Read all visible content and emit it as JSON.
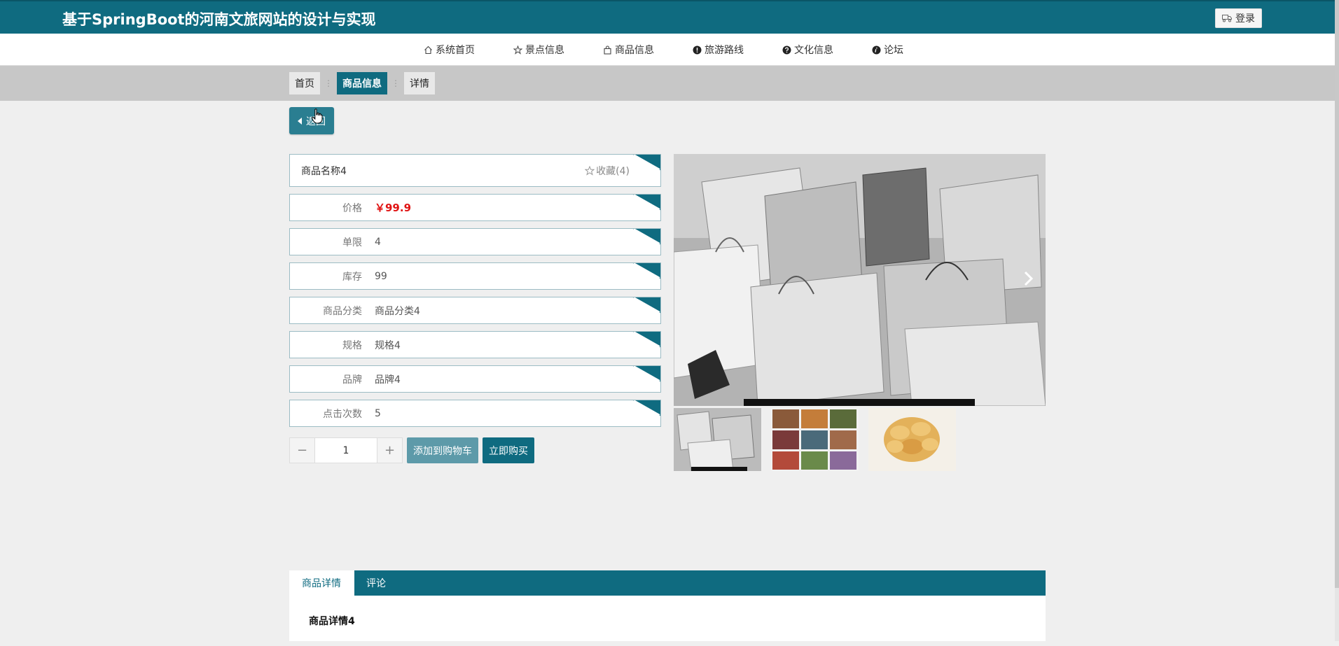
{
  "header": {
    "site_title": "基于SpringBoot的河南文旅网站的设计与实现",
    "login_label": "登录"
  },
  "nav": [
    {
      "label": "系统首页",
      "icon": "home-icon"
    },
    {
      "label": "景点信息",
      "icon": "star-icon"
    },
    {
      "label": "商品信息",
      "icon": "bag-icon"
    },
    {
      "label": "旅游路线",
      "icon": "info-icon"
    },
    {
      "label": "文化信息",
      "icon": "question-icon"
    },
    {
      "label": "论坛",
      "icon": "info-icon"
    }
  ],
  "breadcrumb": [
    {
      "label": "首页",
      "active": false
    },
    {
      "label": "商品信息",
      "active": true
    },
    {
      "label": "详情",
      "active": false
    }
  ],
  "back_label": "返回",
  "product": {
    "name": "商品名称4",
    "favorite_label": "收藏(4)",
    "fields": [
      {
        "label": "价格",
        "value": "￥99.9",
        "kind": "price"
      },
      {
        "label": "单限",
        "value": "4"
      },
      {
        "label": "库存",
        "value": "99"
      },
      {
        "label": "商品分类",
        "value": "商品分类4"
      },
      {
        "label": "规格",
        "value": "规格4"
      },
      {
        "label": "品牌",
        "value": "品牌4"
      },
      {
        "label": "点击次数",
        "value": "5"
      }
    ]
  },
  "buy": {
    "quantity": "1",
    "add_to_cart_label": "添加到购物车",
    "buy_now_label": "立即购买"
  },
  "tabs": [
    {
      "label": "商品详情",
      "active": true
    },
    {
      "label": "评论",
      "active": false
    }
  ],
  "detail_content": "商品详情4",
  "colors": {
    "primary": "#0f6b80",
    "price": "#e01414",
    "crumb_bar": "#c7c7c7"
  }
}
